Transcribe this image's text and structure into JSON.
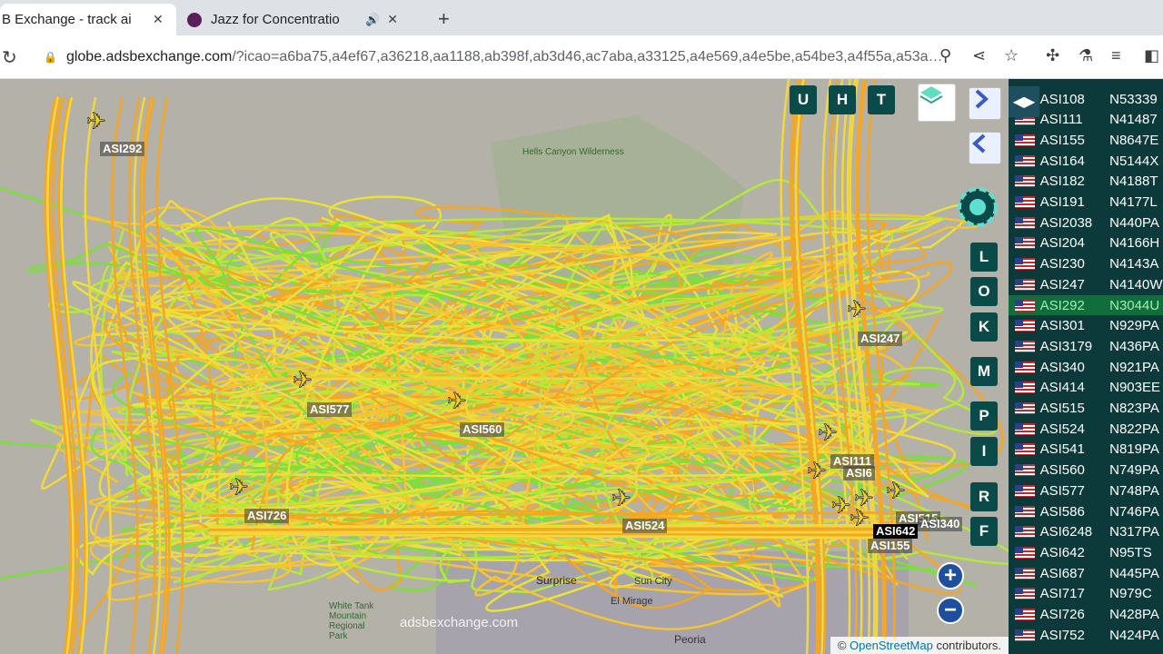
{
  "tabs": [
    {
      "title": "B Exchange - track ai"
    },
    {
      "title": "Jazz for Concentratio"
    }
  ],
  "address": {
    "host": "globe.adsbexchange.com",
    "path": "/?icao=a6ba75,a4ef67,a36218,aa1188,ab398f,ab3d46,ac7aba,a33125,a4e569,a4e5be,a54be3,a4f55a,a53a…"
  },
  "map": {
    "layer_buttons": [
      "U",
      "H",
      "T"
    ],
    "side_buttons": [
      "L",
      "O",
      "K",
      "M",
      "P",
      "I",
      "R",
      "F"
    ],
    "aircraft": [
      {
        "label": "ASI292"
      },
      {
        "label": "ASI247"
      },
      {
        "label": "ASI577"
      },
      {
        "label": "ASI560"
      },
      {
        "label": "ASI111"
      },
      {
        "label": "ASI6"
      },
      {
        "label": "ASI726"
      },
      {
        "label": "ASI524"
      },
      {
        "label": "ASI515"
      },
      {
        "label": "ASI642"
      },
      {
        "label": "ASI340"
      },
      {
        "label": "ASI155"
      }
    ],
    "places": [
      "Hells Canyon Wilderness",
      "Surprise",
      "Sun City",
      "El Mirage",
      "White Tank Mountain Regional Park",
      "Peoria"
    ],
    "watermark": "adsbexchange.com",
    "attribution_prefix": "©",
    "attribution_link": "OpenStreetMap",
    "attribution_suffix": "contributors."
  },
  "sidebar": {
    "rows": [
      {
        "callsign": "ASI108",
        "reg": "N53339"
      },
      {
        "callsign": "ASI111",
        "reg": "N41487"
      },
      {
        "callsign": "ASI155",
        "reg": "N8647E"
      },
      {
        "callsign": "ASI164",
        "reg": "N5144X"
      },
      {
        "callsign": "ASI182",
        "reg": "N4188T"
      },
      {
        "callsign": "ASI191",
        "reg": "N4177L"
      },
      {
        "callsign": "ASI2038",
        "reg": "N440PA"
      },
      {
        "callsign": "ASI204",
        "reg": "N4166H"
      },
      {
        "callsign": "ASI230",
        "reg": "N4143A"
      },
      {
        "callsign": "ASI247",
        "reg": "N4140W"
      },
      {
        "callsign": "ASI292",
        "reg": "N3044U"
      },
      {
        "callsign": "ASI301",
        "reg": "N929PA"
      },
      {
        "callsign": "ASI3179",
        "reg": "N436PA"
      },
      {
        "callsign": "ASI340",
        "reg": "N921PA"
      },
      {
        "callsign": "ASI414",
        "reg": "N903EE"
      },
      {
        "callsign": "ASI515",
        "reg": "N823PA"
      },
      {
        "callsign": "ASI524",
        "reg": "N822PA"
      },
      {
        "callsign": "ASI541",
        "reg": "N819PA"
      },
      {
        "callsign": "ASI560",
        "reg": "N749PA"
      },
      {
        "callsign": "ASI577",
        "reg": "N748PA"
      },
      {
        "callsign": "ASI586",
        "reg": "N746PA"
      },
      {
        "callsign": "ASI6248",
        "reg": "N317PA"
      },
      {
        "callsign": "ASI642",
        "reg": "N95TS"
      },
      {
        "callsign": "ASI687",
        "reg": "N445PA"
      },
      {
        "callsign": "ASI717",
        "reg": "N979C"
      },
      {
        "callsign": "ASI726",
        "reg": "N428PA"
      },
      {
        "callsign": "ASI752",
        "reg": "N424PA"
      }
    ],
    "selected_index": 10
  },
  "colors": {
    "track_orange": "#f5a623",
    "track_yellow": "#f2d83a",
    "track_green": "#7be03a",
    "sidebar_bg": "#0c3a3a",
    "button_bg": "#0a4b49"
  }
}
